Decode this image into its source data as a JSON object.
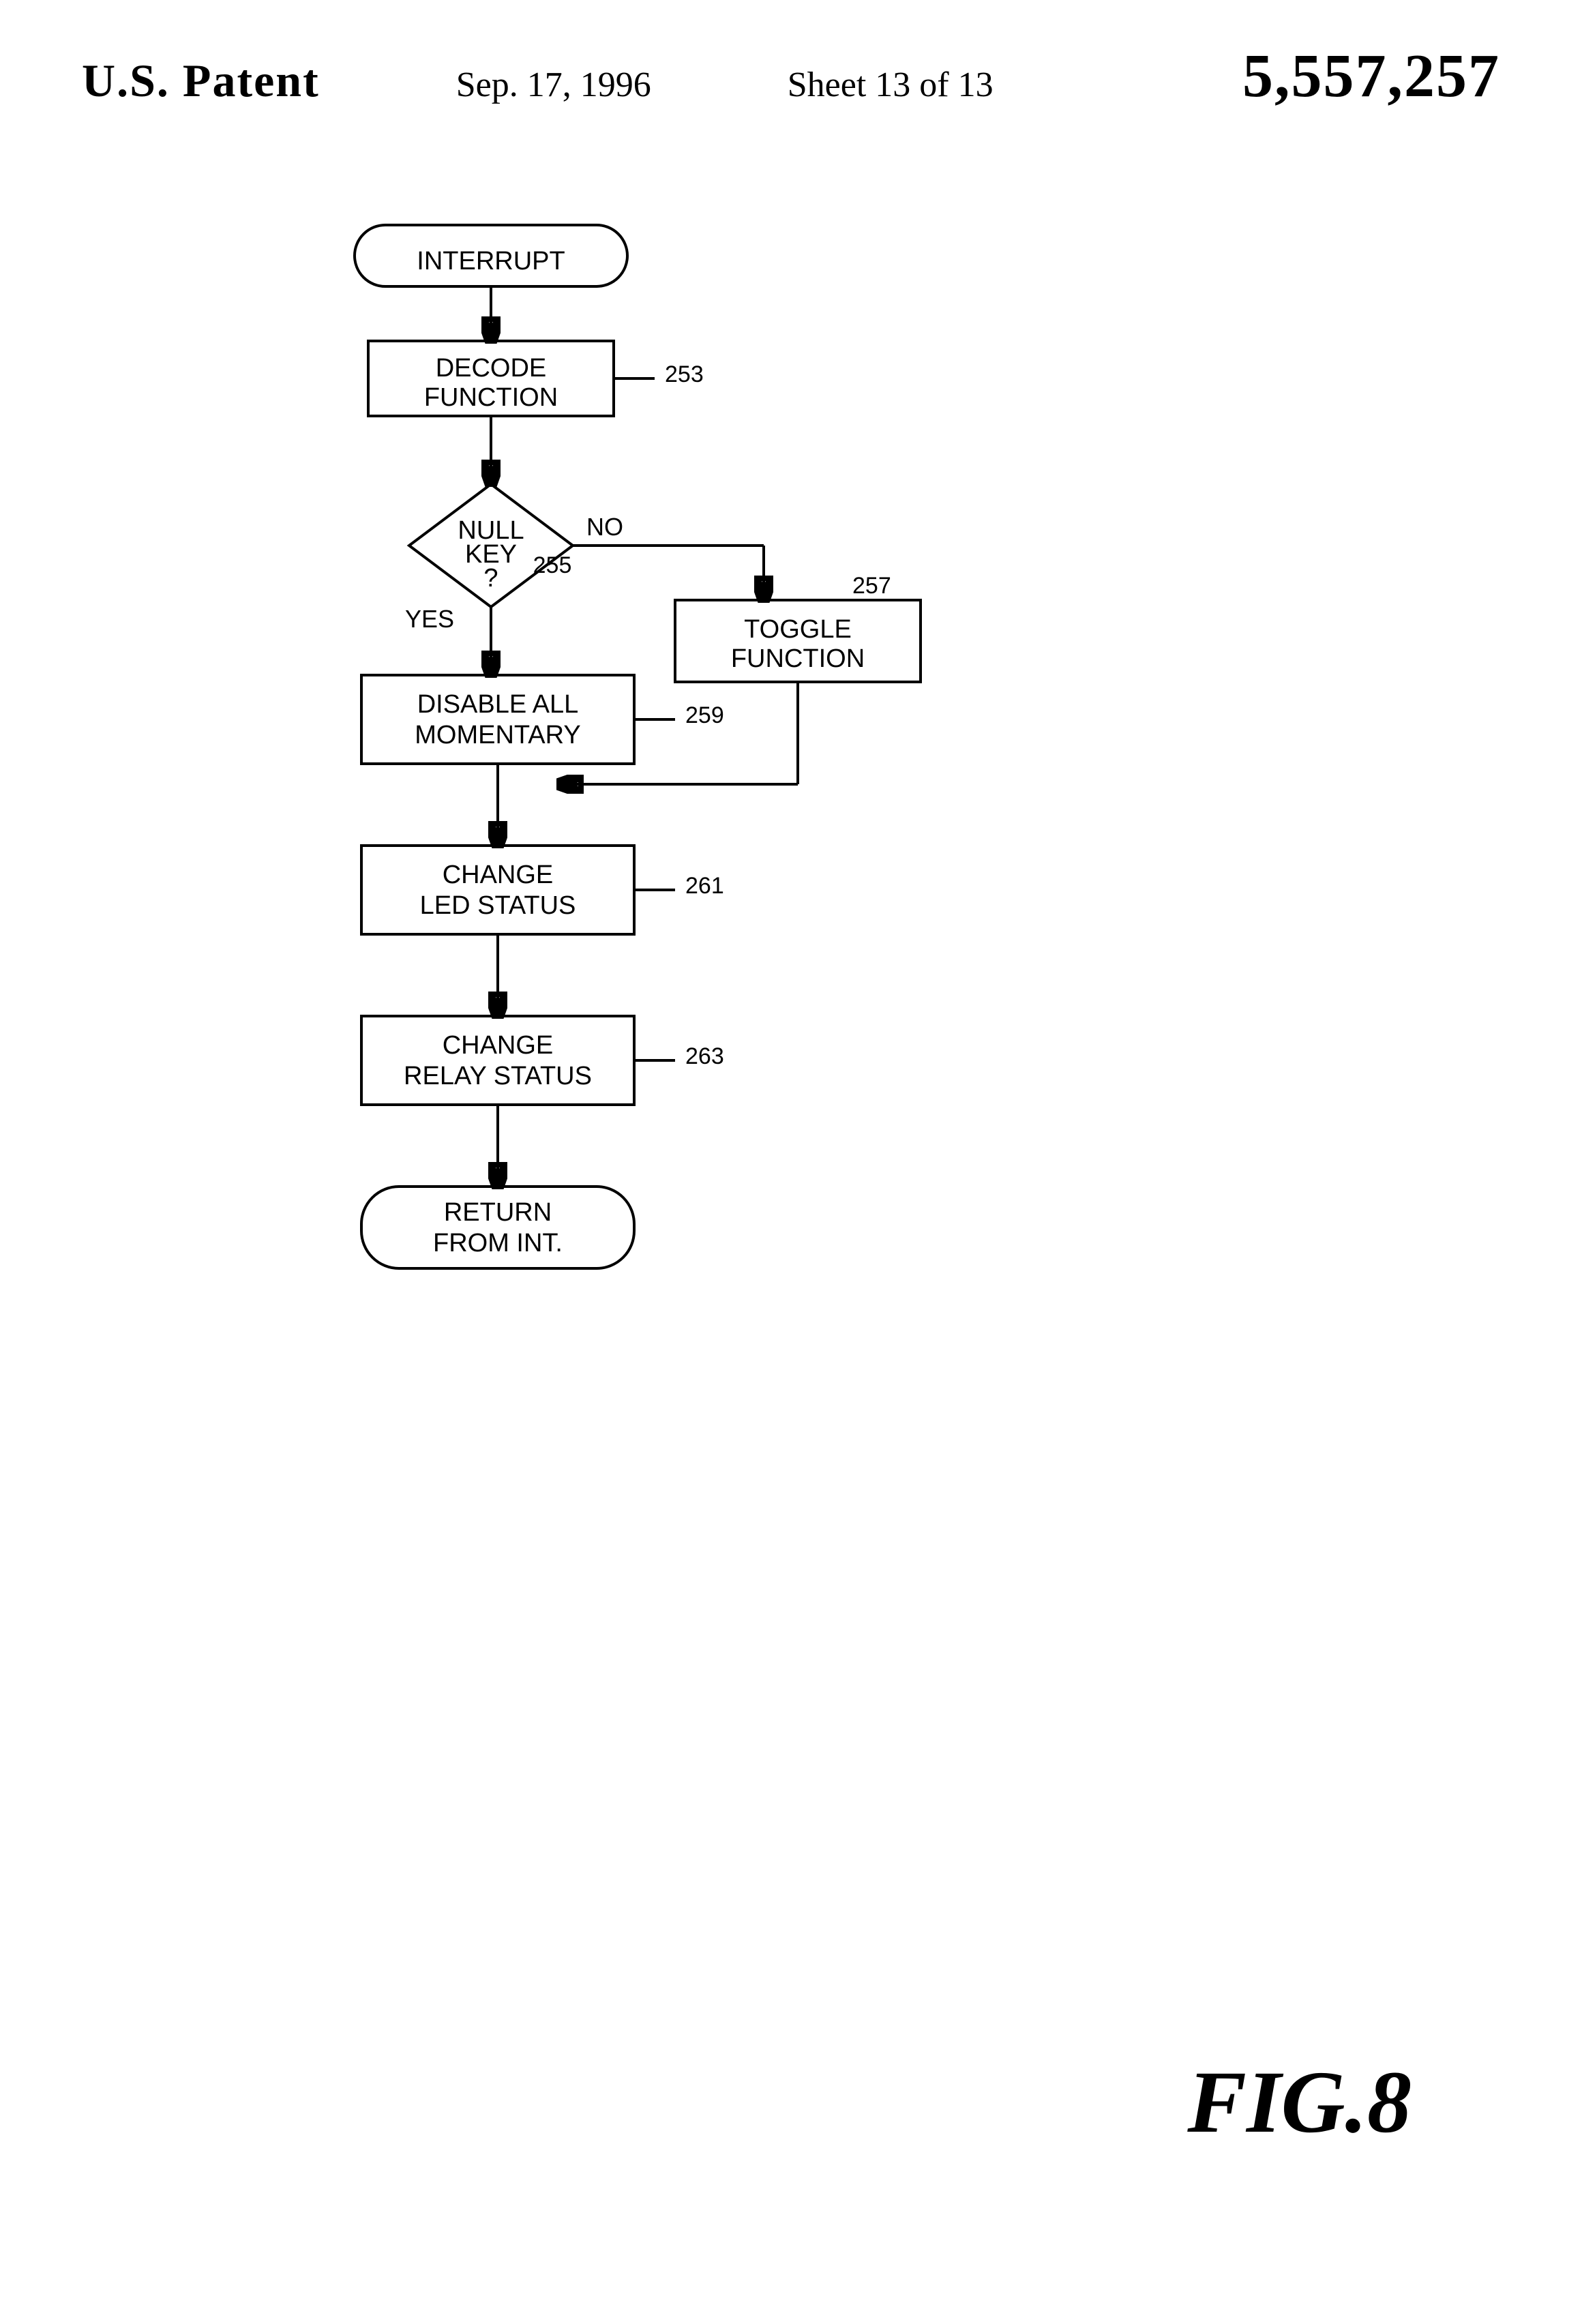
{
  "header": {
    "patent_label": "U.S. Patent",
    "date": "Sep. 17, 1996",
    "sheet": "Sheet 13 of 13",
    "patent_number": "5,557,257"
  },
  "flowchart": {
    "nodes": {
      "interrupt": "INTERRUPT",
      "decode_function": "DECODE\nFUNCTION",
      "null_key": "NULL\nKEY\n?",
      "no_label": "NO",
      "yes_label": "YES",
      "toggle_function": "TOGGLE\nFUNCTION",
      "disable_all": "DISABLE ALL\nMOMENTARY",
      "change_led": "CHANGE\nLED STATUS",
      "change_relay": "CHANGE\nRELAY STATUS",
      "return_from_int": "RETURN\nFROM INT."
    },
    "labels": {
      "n253": "253",
      "n255": "255",
      "n257": "257",
      "n259": "259",
      "n261": "261",
      "n263": "263"
    }
  },
  "figure": {
    "label": "FIG.8"
  }
}
